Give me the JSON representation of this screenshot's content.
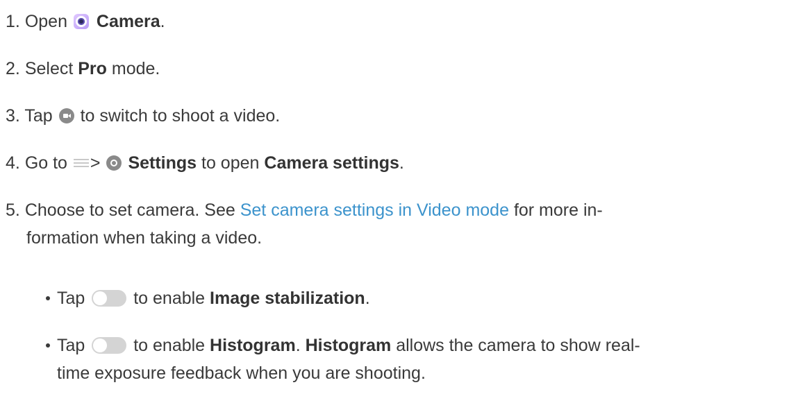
{
  "steps": [
    {
      "num": "1.",
      "pre": "Open",
      "bold": "Camera",
      "post": "."
    },
    {
      "num": "2.",
      "pre": "Select",
      "bold": "Pro",
      "post": "mode."
    },
    {
      "num": "3.",
      "pre": "Tap",
      "post": "to switch to shoot a video."
    },
    {
      "num": "4.",
      "pre": "Go to",
      "gt": ">",
      "bold": "Settings",
      "mid": "to open",
      "bold2": "Camera settings",
      "post": "."
    },
    {
      "num": "5.",
      "pre": "Choose to set camera. See",
      "link": "Set camera settings in Video mode",
      "post": "for more in-",
      "cont": "formation when taking a video."
    }
  ],
  "bullets": [
    {
      "pre": "Tap",
      "mid": "to enable",
      "bold": "Image stabilization",
      "post": "."
    },
    {
      "pre": "Tap",
      "mid": "to enable",
      "bold": "Histogram",
      "post": ".",
      "bold2": "Histogram",
      "post2": "allows the camera to show real-",
      "cont": "time exposure feedback when you are shooting."
    }
  ],
  "icons": {
    "camera": "camera-app-icon",
    "video": "video-mode-icon",
    "menu": "menu-icon",
    "settings": "settings-gear-icon",
    "toggle": "toggle-switch-icon"
  },
  "colors": {
    "text": "#3a3a3a",
    "link": "#3c93cc"
  }
}
